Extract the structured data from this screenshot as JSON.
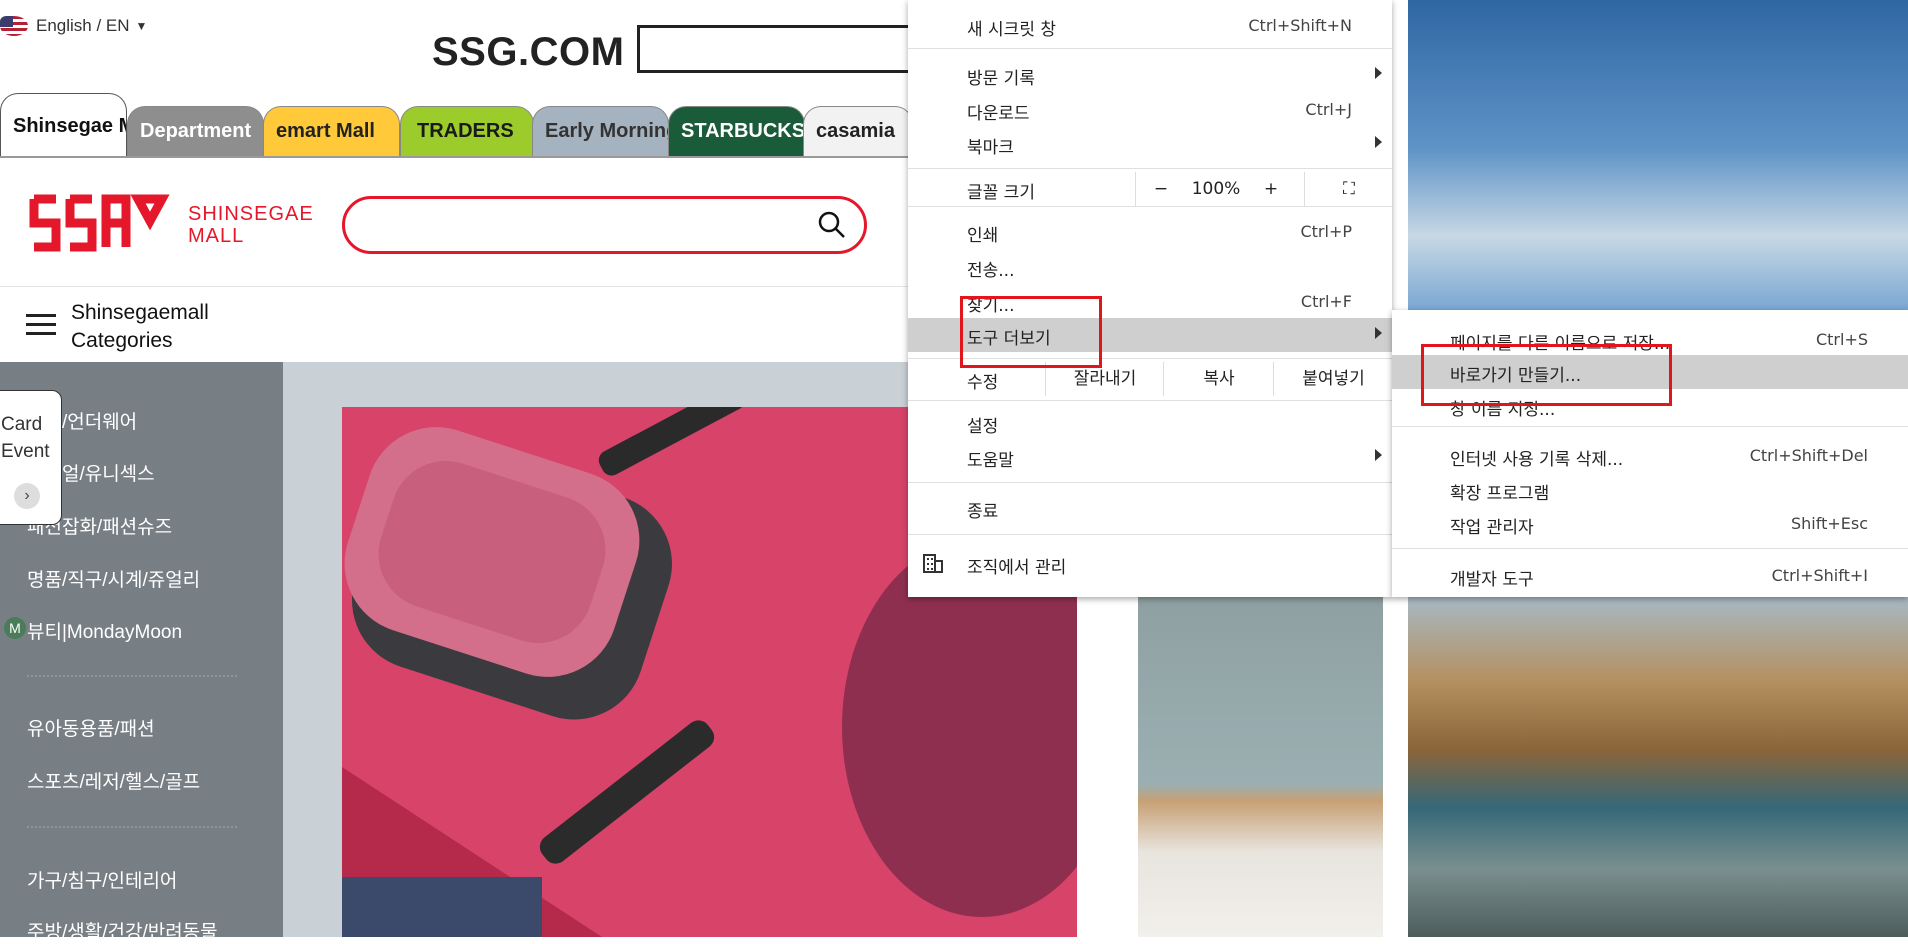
{
  "top": {
    "language": "English / EN",
    "site_logo": "SSG.COM"
  },
  "tabs": [
    {
      "label": "Shinsegae Mall",
      "bg": "#ffffff",
      "color": "#111111"
    },
    {
      "label": "Department",
      "bg": "#8e8e8e",
      "color": "#ffffff"
    },
    {
      "label": "emart Mall",
      "bg": "#ffc93a",
      "color": "#222222"
    },
    {
      "label": "TRADERS",
      "bg": "#9ccc2c",
      "color": "#1a1a1a"
    },
    {
      "label": "Early Morning",
      "bg": "#a5b2c0",
      "color": "#333333"
    },
    {
      "label": "STARBUCKS",
      "bg": "#1a5c3a",
      "color": "#ffffff"
    },
    {
      "label": "casamia",
      "bg": "#f2f2f2",
      "color": "#222222"
    }
  ],
  "brand": {
    "logo_text_line1": "SHINSEGAE",
    "logo_text_line2": "MALL",
    "accent": "#e4182a"
  },
  "categories_title_line1": "Shinsegaemall",
  "categories_title_line2": "Categories",
  "sidebar": {
    "items": [
      "패션/언더웨어",
      "캐쥬얼/유니섹스",
      "패션잡화/패션슈즈",
      "명품/직구/시계/쥬얼리",
      "뷰티|MondayMoon",
      "유아동용품/패션",
      "스포츠/레저/헬스/골프",
      "가구/침구/인테리어",
      "주방/생활/건강/반려동물"
    ],
    "card_event_line1": "Card",
    "card_event_line2": "Event",
    "m_badge": "M"
  },
  "menu": {
    "incognito": {
      "label": "새 시크릿 창",
      "shortcut": "Ctrl+Shift+N"
    },
    "history": {
      "label": "방문 기록"
    },
    "downloads": {
      "label": "다운로드",
      "shortcut": "Ctrl+J"
    },
    "bookmarks": {
      "label": "북마크"
    },
    "zoom": {
      "label": "글꼴 크기",
      "minus": "−",
      "value": "100%",
      "plus": "+"
    },
    "print": {
      "label": "인쇄",
      "shortcut": "Ctrl+P"
    },
    "cast": {
      "label": "전송..."
    },
    "find": {
      "label": "찾기...",
      "shortcut": "Ctrl+F"
    },
    "more_tools": {
      "label": "도구 더보기"
    },
    "edit": {
      "label": "수정",
      "cut": "잘라내기",
      "copy": "복사",
      "paste": "붙여넣기"
    },
    "settings": {
      "label": "설정"
    },
    "help": {
      "label": "도움말"
    },
    "exit": {
      "label": "종료"
    },
    "managed": {
      "label": "조직에서 관리"
    }
  },
  "submenu": {
    "save_as": {
      "label": "페이지를 다른 이름으로 저장...",
      "shortcut": "Ctrl+S"
    },
    "create_shortcut": {
      "label": "바로가기 만들기..."
    },
    "name_window": {
      "label": "창 이름 지정..."
    },
    "clear_data": {
      "label": "인터넷 사용 기록 삭제...",
      "shortcut": "Ctrl+Shift+Del"
    },
    "extensions": {
      "label": "확장 프로그램"
    },
    "task_manager": {
      "label": "작업 관리자",
      "shortcut": "Shift+Esc"
    },
    "dev_tools": {
      "label": "개발자 도구",
      "shortcut": "Ctrl+Shift+I"
    }
  },
  "colors": {
    "highlight": "#cfcfcf",
    "annotation_red": "#e0161b"
  }
}
